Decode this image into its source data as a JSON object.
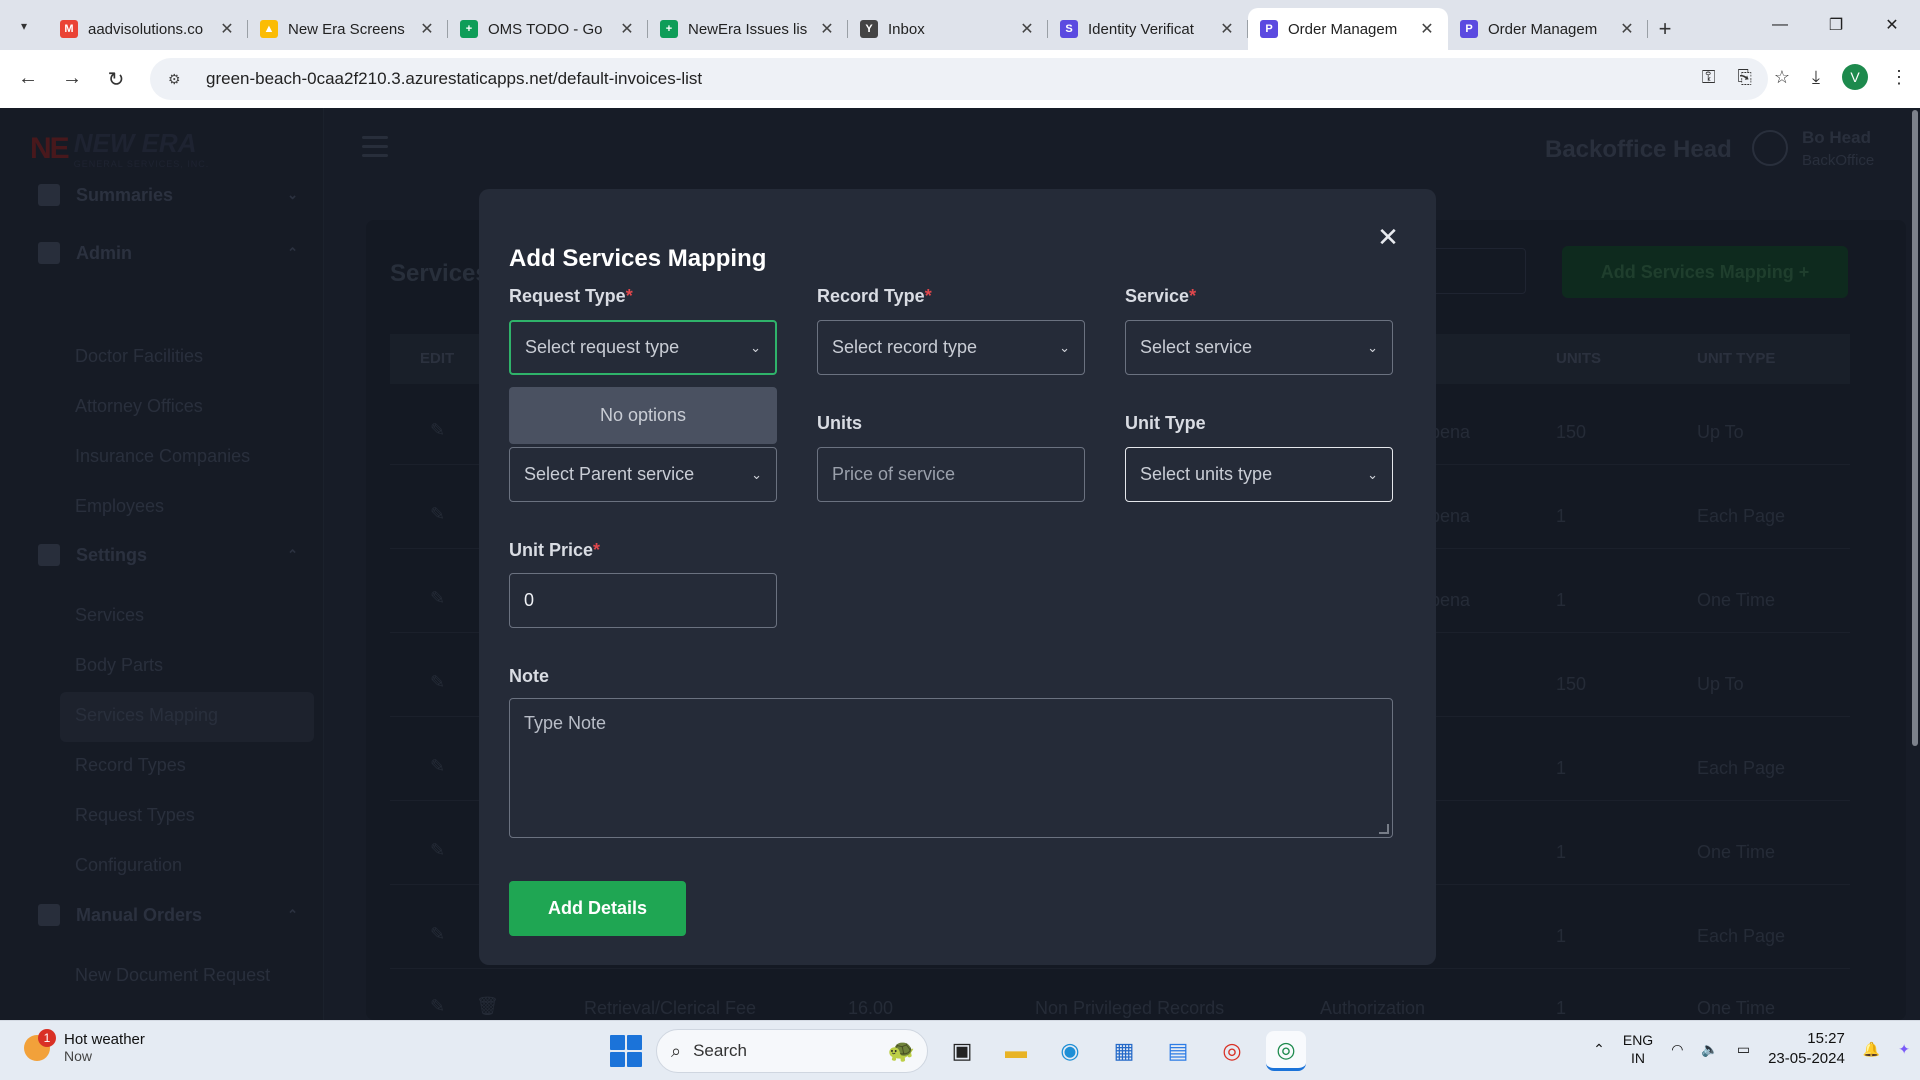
{
  "browser": {
    "tabs": [
      {
        "title": "aadvisolutions.co",
        "icon": "gmail-icon",
        "color": "#ea4335",
        "glyph": "M"
      },
      {
        "title": "New Era Screens",
        "icon": "drive-icon",
        "color": "#fbbc04",
        "glyph": "▲"
      },
      {
        "title": "OMS TODO - Go",
        "icon": "sheets-icon",
        "color": "#0f9d58",
        "glyph": "+"
      },
      {
        "title": "NewEra Issues lis",
        "icon": "sheets-icon",
        "color": "#0f9d58",
        "glyph": "+"
      },
      {
        "title": "Inbox",
        "icon": "yahoo-icon",
        "color": "#444444",
        "glyph": "Y"
      },
      {
        "title": "Identity Verificat",
        "icon": "s-icon",
        "color": "#5b4ae0",
        "glyph": "S"
      },
      {
        "title": "Order Managem",
        "icon": "app-icon",
        "color": "#5b4ae0",
        "glyph": "P"
      },
      {
        "title": "Order Managem",
        "icon": "app-icon",
        "color": "#5b4ae0",
        "glyph": "P"
      }
    ],
    "active_tab": 6,
    "url": "green-beach-0caa2f210.3.azurestaticapps.net/default-invoices-list",
    "profile_initial": "V"
  },
  "app": {
    "logo_mark": "NE",
    "logo_name": "NEW ERA",
    "logo_sub": "GENERAL SERVICES, INC.",
    "role_title": "Backoffice Head",
    "user_name": "Bo Head",
    "user_role": "BackOffice",
    "sidebar": {
      "groups": [
        {
          "label": "Summaries"
        },
        {
          "label": "Admin"
        },
        {
          "label": "Settings"
        },
        {
          "label": "Manual Orders"
        }
      ],
      "items": [
        "Doctor Facilities",
        "Attorney Offices",
        "Insurance Companies",
        "Employees",
        "Services",
        "Body Parts",
        "Services Mapping",
        "Record Types",
        "Request Types",
        "Configuration",
        "New Document Request"
      ]
    },
    "page_title": "Services",
    "add_button": "Add Services Mapping +",
    "table": {
      "headers": [
        "EDIT",
        "UNITS",
        "UNIT TYPE"
      ],
      "rows": [
        {
          "col_e": "pena",
          "units": "150",
          "unit_type": "Up To"
        },
        {
          "col_e": "pena",
          "units": "1",
          "unit_type": "Each Page"
        },
        {
          "col_e": "pena",
          "units": "1",
          "unit_type": "One Time"
        },
        {
          "col_e": "",
          "units": "150",
          "unit_type": "Up To"
        },
        {
          "col_e": "",
          "units": "1",
          "unit_type": "Each Page"
        },
        {
          "col_e": "",
          "units": "1",
          "unit_type": "One Time"
        },
        {
          "col_e": "",
          "units": "1",
          "unit_type": "Each Page"
        }
      ],
      "last_row": {
        "name": "Retrieval/Clerical Fee",
        "price": "16.00",
        "record": "Non Privileged Records",
        "request": "Authorization",
        "units": "1",
        "unit_type": "One Time"
      }
    }
  },
  "modal": {
    "title": "Add Services Mapping",
    "fields": {
      "request_type": {
        "label": "Request Type",
        "placeholder": "Select request type"
      },
      "record_type": {
        "label": "Record Type",
        "placeholder": "Select record type"
      },
      "service": {
        "label": "Service",
        "placeholder": "Select service"
      },
      "parent_service": {
        "placeholder": "Select Parent service"
      },
      "units": {
        "label": "Units",
        "placeholder": "Price of service"
      },
      "unit_type": {
        "label": "Unit Type",
        "placeholder": "Select units type"
      },
      "unit_price": {
        "label": "Unit Price",
        "value": "0"
      },
      "note": {
        "label": "Note",
        "placeholder": "Type Note"
      }
    },
    "dropdown_empty": "No options",
    "required_mark": "*",
    "submit": "Add Details"
  },
  "taskbar": {
    "weather_title": "Hot weather",
    "weather_sub": "Now",
    "weather_badge": "1",
    "search_label": "Search",
    "lang_top": "ENG",
    "lang_bottom": "IN",
    "time": "15:27",
    "date": "23-05-2024"
  }
}
